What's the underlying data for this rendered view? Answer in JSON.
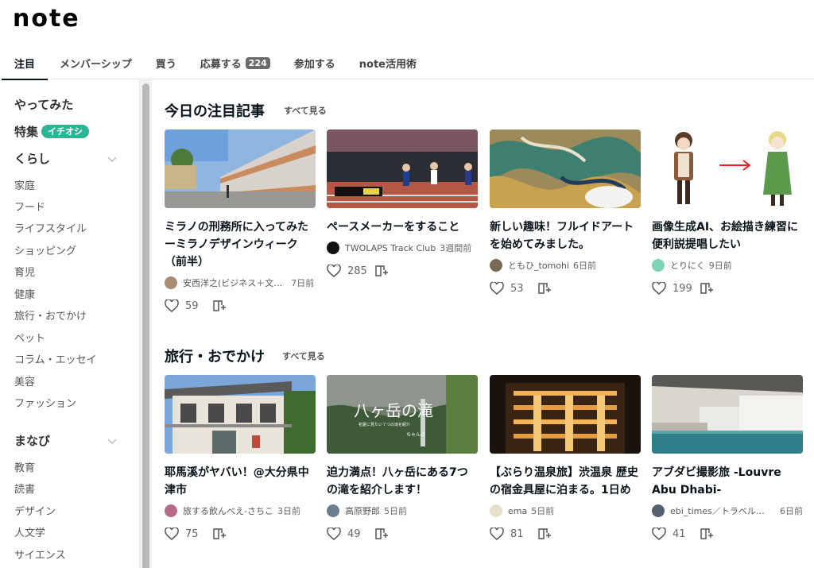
{
  "header": {
    "logo": "note"
  },
  "tabs": [
    {
      "label": "注目",
      "active": true
    },
    {
      "label": "メンバーシップ"
    },
    {
      "label": "買う"
    },
    {
      "label": "応募する",
      "badge": "224"
    },
    {
      "label": "参加する"
    },
    {
      "label": "note活用術"
    }
  ],
  "sidebar": {
    "top": [
      "やってみた",
      "特集"
    ],
    "feature_badge": "イチオシ",
    "groups": [
      {
        "label": "くらし",
        "items": [
          "家庭",
          "フード",
          "ライフスタイル",
          "ショッピング",
          "育児",
          "健康",
          "旅行・おでかけ",
          "ペット",
          "コラム・エッセイ",
          "美容",
          "ファッション"
        ]
      },
      {
        "label": "まなび",
        "items": [
          "教育",
          "読書",
          "デザイン",
          "人文学",
          "サイエンス"
        ]
      }
    ]
  },
  "sections": [
    {
      "title": "今日の注目記事",
      "see_all": "すべて見る",
      "cards": [
        {
          "title": "ミラノの刑務所に入ってみたーミラノデザインウィーク（前半）",
          "author": "安西洋之(ビジネス＋文…",
          "date": "7日前",
          "likes": "59"
        },
        {
          "title": "ペースメーカーをすること",
          "author": "TWOLAPS Track Club",
          "date": "3週間前",
          "likes": "285"
        },
        {
          "title": "新しい趣味！フルイドアートを始めてみました。",
          "author": "ともひ_tomohi",
          "date": "6日前",
          "likes": "53"
        },
        {
          "title": "画像生成AI、お絵描き練習に便利説提唱したい",
          "author": "とりにく",
          "date": "9日前",
          "likes": "199"
        }
      ]
    },
    {
      "title": "旅行・おでかけ",
      "see_all": "すべて見る",
      "cards": [
        {
          "title": "耶馬溪がヤバい！@大分県中津市",
          "author": "旅する飲んべえ-さちこ",
          "date": "3日前",
          "likes": "75"
        },
        {
          "title": "迫力満点！八ヶ岳にある7つの滝を紹介します！",
          "author": "高原野郎",
          "date": "5日前",
          "likes": "49",
          "thumb_text": "八ヶ岳の滝",
          "thumb_sub": "初夏に見たい７つの滝を紹介",
          "thumb_sign": "ちゃんさ"
        },
        {
          "title": "【ぶらり温泉旅】渋温泉 歴史の宿金具屋に泊まる。1日め",
          "author": "ema",
          "date": "5日前",
          "likes": "81"
        },
        {
          "title": "アブダビ撮影旅 -Louvre Abu Dhabi-",
          "author": "ebi_times／トラベルフ…",
          "date": "6日前",
          "likes": "41"
        }
      ]
    }
  ],
  "colors": {
    "accent": "#2cb696",
    "badge_gray": "#6c6c6c",
    "text": "#08131a"
  }
}
